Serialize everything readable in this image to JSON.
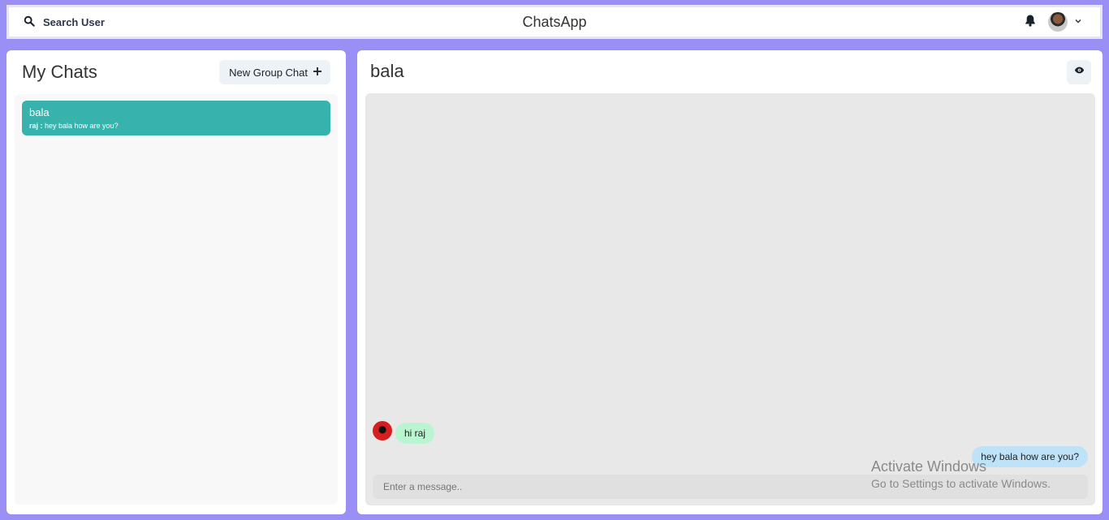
{
  "header": {
    "search_label": "Search User",
    "app_title": "ChatsApp"
  },
  "sidebar": {
    "title": "My Chats",
    "new_group_label": "New Group Chat",
    "chats": [
      {
        "name": "bala",
        "last_sender": "raj",
        "separator": " : ",
        "last_message": "hey bala how are you?"
      }
    ]
  },
  "conversation": {
    "title": "bala",
    "messages": [
      {
        "text": "hi raj",
        "side": "left"
      },
      {
        "text": "hey bala how are you?",
        "side": "right"
      }
    ],
    "input_placeholder": "Enter a message.."
  },
  "watermark": {
    "title": "Activate Windows",
    "subtitle": "Go to Settings to activate Windows."
  },
  "colors": {
    "background": "#9a8ff5",
    "selected_chat": "#38b2ac",
    "received_bubble": "#b9f5d0",
    "sent_bubble": "#bee3f8"
  },
  "icons": [
    "search-icon",
    "bell-icon",
    "avatar",
    "chevron-down-icon",
    "plus-icon",
    "eye-icon"
  ]
}
